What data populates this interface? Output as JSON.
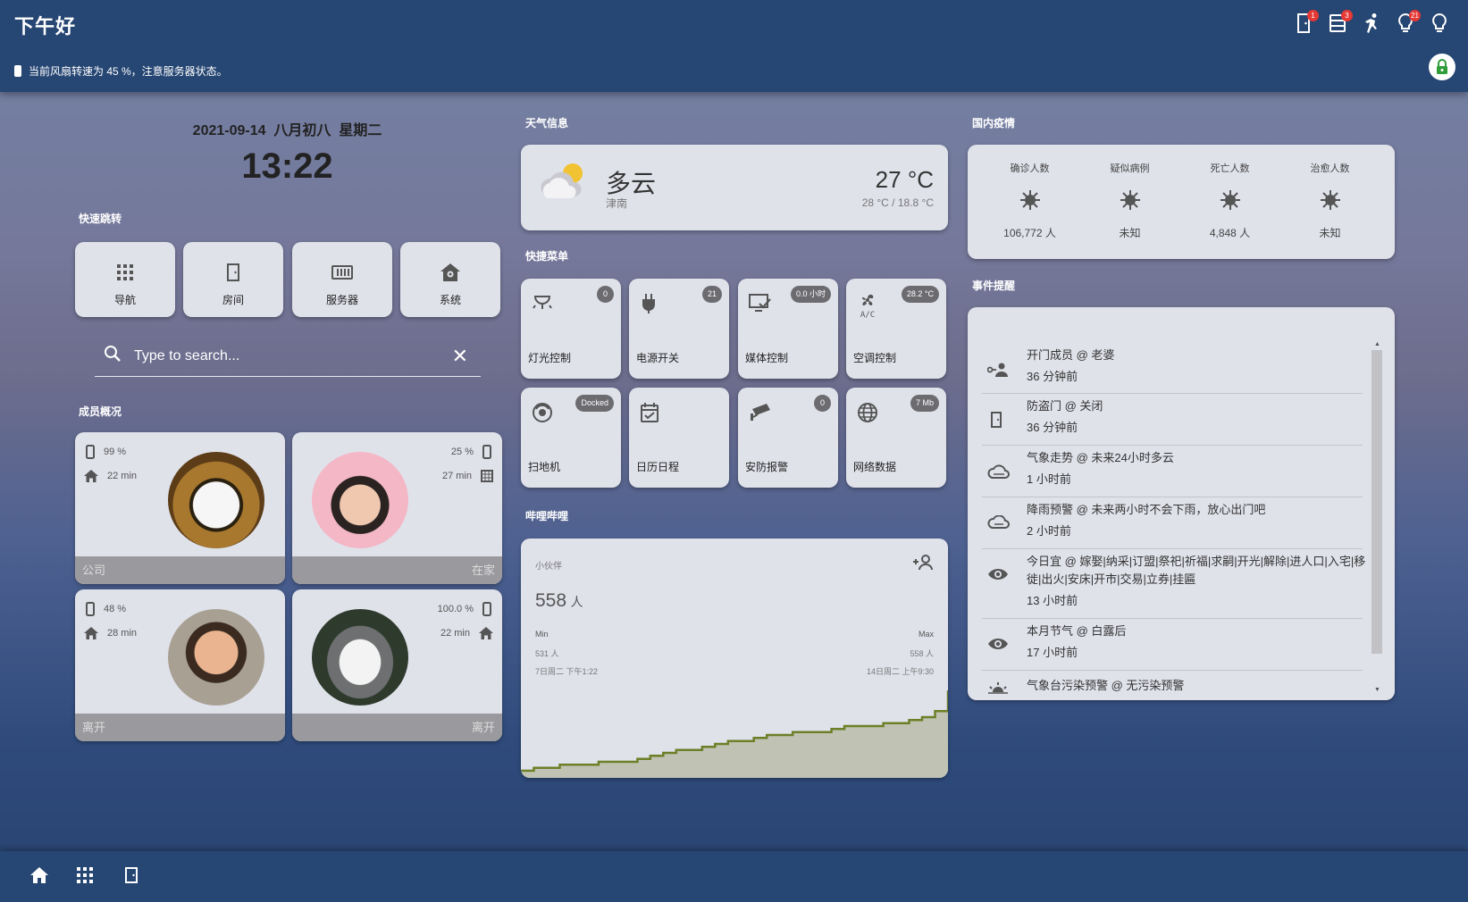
{
  "header": {
    "greeting": "下午好",
    "notice": "当前风扇转速为 45 %，注意服务器状态。",
    "icons": [
      {
        "name": "door-icon",
        "badge": "1"
      },
      {
        "name": "server-icon",
        "badge": "3"
      },
      {
        "name": "run-icon",
        "badge": ""
      },
      {
        "name": "lightbulb-alert-icon",
        "badge": "21"
      },
      {
        "name": "lightbulb-icon",
        "badge": ""
      }
    ],
    "lock_icon": "lock-icon"
  },
  "datetime": {
    "date": "2021-09-14",
    "lunar": "八月初八",
    "weekday": "星期二",
    "time": "13:22"
  },
  "quick_jump": {
    "title": "快速跳转",
    "buttons": [
      {
        "label": "导航",
        "icon": "grid-icon"
      },
      {
        "label": "房间",
        "icon": "door-icon"
      },
      {
        "label": "服务器",
        "icon": "server-icon"
      },
      {
        "label": "系统",
        "icon": "home-gear-icon"
      }
    ]
  },
  "search": {
    "placeholder": "Type to search..."
  },
  "members": {
    "title": "成员概况",
    "items": [
      {
        "battery": "99 %",
        "duration": "22 min",
        "location": "公司",
        "align": "left"
      },
      {
        "battery": "25 %",
        "duration": "27 min",
        "location": "在家",
        "align": "right"
      },
      {
        "battery": "48 %",
        "duration": "28 min",
        "location": "离开",
        "align": "left"
      },
      {
        "battery": "100.0 %",
        "duration": "22 min",
        "location": "离开",
        "align": "right"
      }
    ]
  },
  "weather": {
    "title": "天气信息",
    "condition": "多云",
    "city": "津南",
    "temp": "27 °C",
    "range": "28 °C / 18.8 °C",
    "icon": "partly-cloudy-icon"
  },
  "quick_menu": {
    "title": "快捷菜单",
    "items": [
      {
        "label": "灯光控制",
        "badge": "0",
        "icon": "ceiling-light-icon"
      },
      {
        "label": "电源开关",
        "badge": "21",
        "icon": "power-plug-icon"
      },
      {
        "label": "媒体控制",
        "badge": "0.0 小时",
        "icon": "monitor-check-icon"
      },
      {
        "label": "空调控制",
        "badge": "28.2 °C",
        "icon": "air-conditioner-icon"
      },
      {
        "label": "扫地机",
        "badge": "Docked",
        "icon": "robot-vacuum-icon"
      },
      {
        "label": "日历日程",
        "badge": "",
        "icon": "calendar-check-icon"
      },
      {
        "label": "安防报警",
        "badge": "0",
        "icon": "cctv-icon"
      },
      {
        "label": "网络数据",
        "badge": "7 Mb",
        "icon": "globe-icon"
      }
    ]
  },
  "bilibili": {
    "title": "哔哩哔哩",
    "label": "小伙伴",
    "value": "558",
    "unit": "人",
    "min_label": "Min",
    "max_label": "Max",
    "min_value": "531 人",
    "max_value": "558 人",
    "min_time": "7日周二 下午1:22",
    "max_time": "14日周二 上午9:30",
    "icon": "account-plus-icon"
  },
  "chart_data": {
    "type": "line",
    "title": "",
    "ylabel": "",
    "xlabel": "",
    "x": [
      "7日周二 下午1:22",
      "",
      "",
      "",
      "",
      "",
      "",
      "",
      "",
      "",
      "",
      "",
      "",
      "",
      "",
      "",
      "",
      "",
      "",
      "",
      "",
      "",
      "",
      "",
      "",
      "",
      "",
      "",
      "",
      "",
      "",
      "",
      "",
      "14日周二 上午9:30"
    ],
    "series": [
      {
        "name": "",
        "values": [
          531,
          532,
          532,
          533,
          533,
          533,
          534,
          534,
          534,
          535,
          536,
          537,
          538,
          538,
          539,
          540,
          541,
          541,
          542,
          543,
          543,
          544,
          544,
          544,
          545,
          546,
          546,
          546,
          547,
          547,
          548,
          549,
          551,
          558
        ]
      }
    ],
    "ylim": [
      531,
      558
    ]
  },
  "epidemic": {
    "title": "国内疫情",
    "columns": [
      {
        "label": "确诊人数",
        "value": "106,772 人"
      },
      {
        "label": "疑似病例",
        "value": "未知"
      },
      {
        "label": "死亡人数",
        "value": "4,848 人"
      },
      {
        "label": "治愈人数",
        "value": "未知"
      }
    ],
    "icon": "virus-icon"
  },
  "events": {
    "title": "事件提醒",
    "items": [
      {
        "line1": "开门成员 @ 老婆",
        "line2": "36 分钟前",
        "icon": "account-key-icon"
      },
      {
        "line1": "防盗门 @ 关闭",
        "line2": "36 分钟前",
        "icon": "door-icon"
      },
      {
        "line1": "气象走势 @ 未来24小时多云",
        "line2": "1 小时前",
        "icon": "cloud-icon"
      },
      {
        "line1": "降雨预警 @ 未来两小时不会下雨，放心出门吧",
        "line2": "2 小时前",
        "icon": "cloud-rain-icon"
      },
      {
        "line1": "今日宜 @ 嫁娶|纳采|订盟|祭祀|祈福|求嗣|开光|解除|进人口|入宅|移徙|出火|安床|开市|交易|立券|挂匾",
        "line2": "13 小时前",
        "icon": "eye-icon"
      },
      {
        "line1": "本月节气 @ 白露后",
        "line2": "17 小时前",
        "icon": "eye-icon"
      },
      {
        "line1": "气象台污染预警 @ 无污染预警",
        "line2": "",
        "icon": "sun-haze-icon"
      }
    ]
  },
  "bottom_nav": [
    {
      "icon": "home-icon"
    },
    {
      "icon": "grid-icon"
    },
    {
      "icon": "door-icon"
    }
  ]
}
